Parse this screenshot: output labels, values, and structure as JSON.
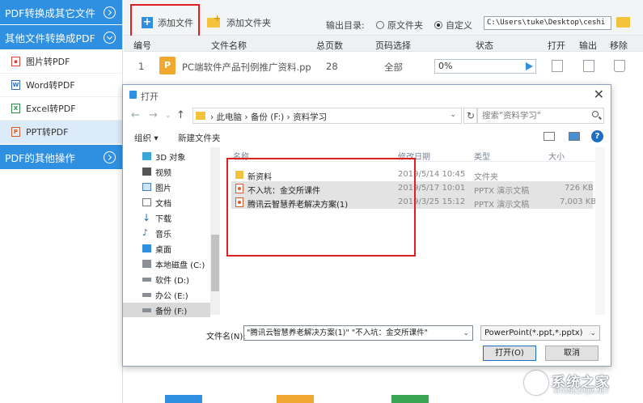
{
  "sidebar": {
    "section1": "PDF转换成其它文件",
    "section2": "其他文件转换成PDF",
    "items": [
      {
        "label": "图片转PDF",
        "icon": "image-file-icon"
      },
      {
        "label": "Word转PDF",
        "icon": "word-file-icon"
      },
      {
        "label": "Excel转PDF",
        "icon": "excel-file-icon"
      },
      {
        "label": "PPT转PDF",
        "icon": "ppt-file-icon"
      }
    ],
    "section3": "PDF的其他操作"
  },
  "toolbar": {
    "add_file": "添加文件",
    "add_folder": "添加文件夹",
    "output_label": "输出目录:",
    "option_original": "原文件夹",
    "option_custom": "自定义",
    "output_path": "C:\\Users\\tuke\\Desktop\\ceshi",
    "selected_option": "自定义"
  },
  "table": {
    "headers": [
      "编号",
      "文件名称",
      "总页数",
      "页码选择",
      "状态",
      "打开",
      "输出",
      "移除"
    ],
    "rows": [
      {
        "index": "1",
        "name": "PC端软件产品刊例推广资料.pp",
        "pages": "28",
        "range": "全部",
        "progress": "0%"
      }
    ]
  },
  "dialog": {
    "title": "打开",
    "breadcrumb": [
      "此电脑",
      "备份 (F:)",
      "资料学习"
    ],
    "search_placeholder": "搜索\"资料学习\"",
    "organize": "组织 ▾",
    "new_folder": "新建文件夹",
    "tree": [
      "3D 对象",
      "视频",
      "图片",
      "文档",
      "下载",
      "音乐",
      "桌面",
      "本地磁盘 (C:)",
      "软件 (D:)",
      "办公 (E:)",
      "备份 (F:)"
    ],
    "tree_selected": "备份 (F:)",
    "columns": [
      "名称",
      "修改日期",
      "类型",
      "大小"
    ],
    "files": [
      {
        "name": "新资料",
        "date": "2019/5/14 10:45",
        "type": "文件夹",
        "size": "",
        "kind": "folder"
      },
      {
        "name": "不入坑：金交所课件",
        "date": "2019/5/17 10:01",
        "type": "PPTX 演示文稿",
        "size": "726 KB",
        "kind": "pptx"
      },
      {
        "name": "腾讯云智慧养老解决方案(1)",
        "date": "2019/3/25 15:12",
        "type": "PPTX 演示文稿",
        "size": "7,003 KB",
        "kind": "pptx"
      }
    ],
    "filename_label": "文件名(N):",
    "filename_value": "\"腾讯云智慧养老解决方案(1)\" \"不入坑：金交所课件\"",
    "filetype": "PowerPoint(*.ppt,*.pptx)",
    "open_button": "打开(O)",
    "cancel_button": "取消"
  },
  "watermark": {
    "text": "系统之家",
    "url": "XITONGZHIJIA.NET"
  },
  "colors": {
    "accent": "#2f8fe0",
    "highlight": "#e02020"
  }
}
